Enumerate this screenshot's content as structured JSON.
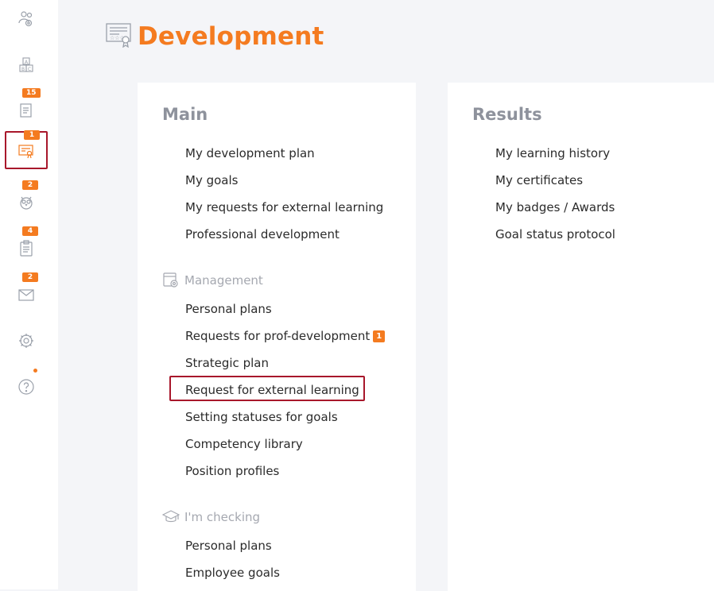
{
  "sidebar": {
    "items": [
      {
        "name": "team",
        "icon": "people-gear-icon",
        "badge": null
      },
      {
        "name": "courses",
        "icon": "abc-blocks-icon",
        "badge": null
      },
      {
        "name": "documents",
        "icon": "document-icon",
        "badge": "15"
      },
      {
        "name": "development",
        "icon": "certificate-icon",
        "badge": "1",
        "active": true
      },
      {
        "name": "owl",
        "icon": "owl-icon",
        "badge": "2"
      },
      {
        "name": "tasks",
        "icon": "clipboard-icon",
        "badge": "4"
      },
      {
        "name": "messages",
        "icon": "envelope-icon",
        "badge": "2"
      },
      {
        "name": "settings",
        "icon": "gear-icon",
        "badge": null
      },
      {
        "name": "help",
        "icon": "question-icon",
        "badge": null,
        "dot": true
      }
    ]
  },
  "header": {
    "title": "Development",
    "icon": "certificate-icon"
  },
  "main": {
    "title": "Main",
    "links": [
      "My development plan",
      "My goals",
      "My requests for external learning",
      "Professional development"
    ],
    "management": {
      "title": "Management",
      "icon": "folder-gear-icon",
      "links": [
        {
          "label": "Personal plans"
        },
        {
          "label": "Requests for prof-development",
          "badge": "1"
        },
        {
          "label": "Strategic plan"
        },
        {
          "label": "Request for external learning",
          "highlighted": true
        },
        {
          "label": "Setting statuses for goals"
        },
        {
          "label": "Competency library"
        },
        {
          "label": "Position profiles"
        }
      ]
    },
    "checking": {
      "title": "I'm checking",
      "icon": "graduation-cap-icon",
      "links": [
        "Personal plans",
        "Employee goals"
      ]
    }
  },
  "results": {
    "title": "Results",
    "links": [
      "My learning history",
      "My certificates",
      "My badges / Awards",
      "Goal status protocol"
    ]
  },
  "colors": {
    "accent": "#f47b20",
    "highlight": "#a8172b",
    "muted": "#8e929c"
  }
}
